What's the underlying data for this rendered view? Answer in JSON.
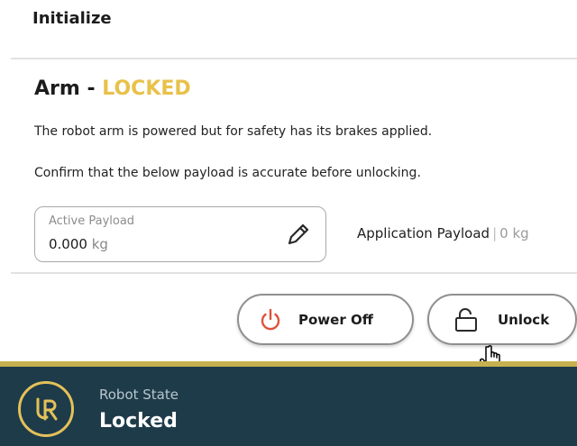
{
  "header": {
    "title": "Initialize"
  },
  "arm": {
    "title": "Arm - ",
    "status": "LOCKED",
    "status_color": "#e8c14a",
    "description": "The robot arm is powered but for safety has its brakes applied.",
    "confirm_text": "Confirm that the below payload is accurate before unlocking."
  },
  "payload": {
    "label": "Active Payload",
    "value": "0.000",
    "unit": "kg",
    "edit_icon": "pencil-icon",
    "application_label": "Application Payload",
    "application_separator": "|",
    "application_value": "0 kg"
  },
  "actions": {
    "power_off_label": "Power Off",
    "power_off_icon": "power-icon",
    "power_icon_color": "#e0523b",
    "unlock_label": "Unlock",
    "unlock_icon": "unlock-icon"
  },
  "footer": {
    "logo": "ur-logo",
    "state_label": "Robot State",
    "state_value": "Locked",
    "background_color": "#1e3b49",
    "accent_color": "#c7b04f"
  }
}
